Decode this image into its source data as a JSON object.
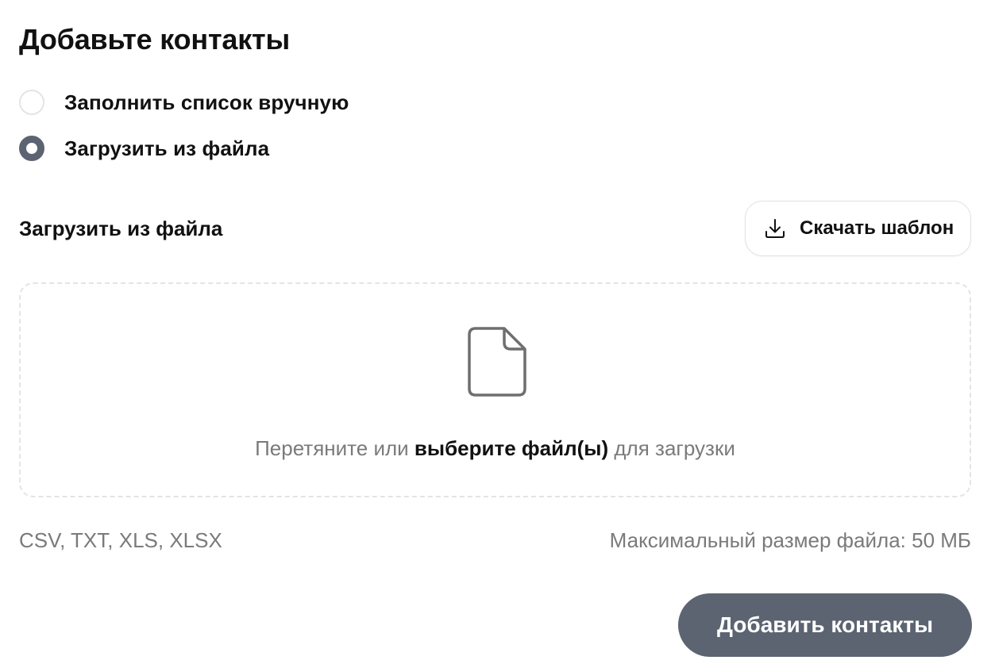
{
  "page": {
    "title": "Добавьте контакты"
  },
  "options": [
    {
      "label": "Заполнить список вручную",
      "selected": false
    },
    {
      "label": "Загрузить из файла",
      "selected": true
    }
  ],
  "upload": {
    "section_title": "Загрузить из файла",
    "download_template_label": "Скачать шаблон",
    "download_icon": "download-icon",
    "file_icon": "file-icon",
    "dropzone_text_before": "Перетяните или ",
    "dropzone_link": "выберите файл(ы)",
    "dropzone_text_after": " для загрузки",
    "formats": "CSV, TXT, XLS, XLSX",
    "max_size": "Максимальный размер файла: 50 МБ"
  },
  "actions": {
    "submit_label": "Добавить контакты"
  },
  "colors": {
    "accent": "#5c6472",
    "text": "#111111",
    "muted_text": "#7a7a7a",
    "border": "#e3e4e7"
  }
}
